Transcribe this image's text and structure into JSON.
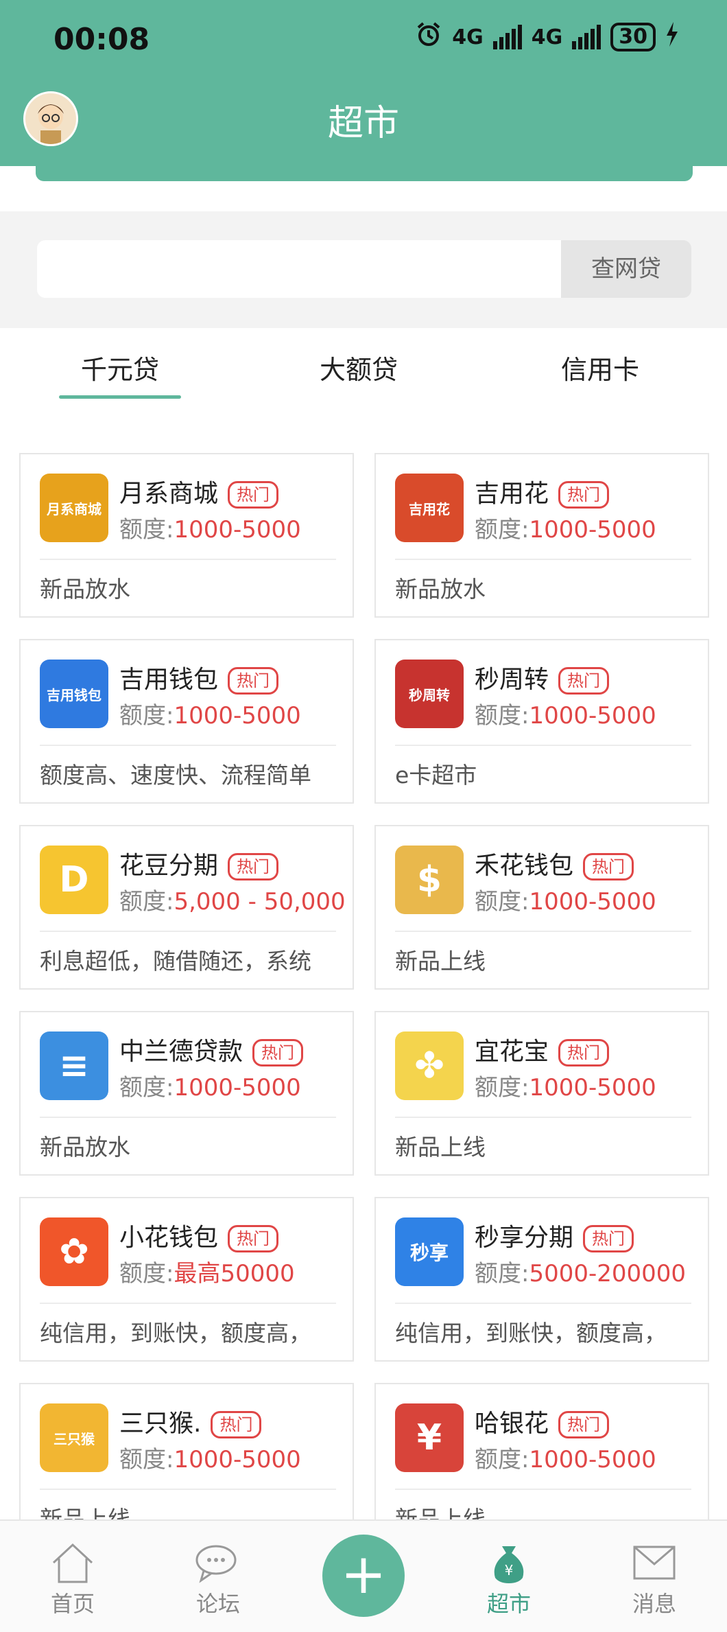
{
  "status_bar": {
    "time": "00:08",
    "net1": "4G",
    "net2": "4G",
    "battery": "30"
  },
  "header": {
    "title": "超市"
  },
  "search": {
    "placeholder": "",
    "button_label": "查网贷"
  },
  "tabs": [
    {
      "label": "千元贷",
      "active": true
    },
    {
      "label": "大额贷",
      "active": false
    },
    {
      "label": "信用卡",
      "active": false
    }
  ],
  "quota_label": "额度:",
  "products": [
    {
      "name": "月系商城",
      "badge": "热门",
      "amount": "1000-5000",
      "desc": "新品放水",
      "logo_text": "月系商城",
      "logo_color": "#e7a21c"
    },
    {
      "name": "吉用花",
      "badge": "热门",
      "amount": "1000-5000",
      "desc": "新品放水",
      "logo_text": "吉用花",
      "logo_color": "#d94b2b"
    },
    {
      "name": "吉用钱包",
      "badge": "热门",
      "amount": "1000-5000",
      "desc": "额度高、速度快、流程简单",
      "logo_text": "吉用钱包",
      "logo_color": "#2f7ae0"
    },
    {
      "name": "秒周转",
      "badge": "热门",
      "amount": "1000-5000",
      "desc": "e卡超市",
      "logo_text": "秒周转",
      "logo_color": "#c7332f"
    },
    {
      "name": "花豆分期",
      "badge": "热门",
      "amount": "5,000 - 50,000",
      "desc": "利息超低，随借随还，系统",
      "logo_text": "D",
      "logo_color": "#f6c530"
    },
    {
      "name": "禾花钱包",
      "badge": "热门",
      "amount": "1000-5000",
      "desc": "新品上线",
      "logo_text": "$",
      "logo_color": "#e9b84c"
    },
    {
      "name": "中兰德贷款",
      "badge": "热门",
      "amount": "1000-5000",
      "desc": "新品放水",
      "logo_text": "≡",
      "logo_color": "#3c8fe0"
    },
    {
      "name": "宜花宝",
      "badge": "热门",
      "amount": "1000-5000",
      "desc": "新品上线",
      "logo_text": "✤",
      "logo_color": "#f4d44d"
    },
    {
      "name": "小花钱包",
      "badge": "热门",
      "amount": "最高50000",
      "desc": "纯信用，到账快，额度高，",
      "logo_text": "✿",
      "logo_color": "#f0562a"
    },
    {
      "name": "秒享分期",
      "badge": "热门",
      "amount": "5000-200000",
      "desc": "纯信用，到账快，额度高，",
      "logo_text": "秒享",
      "logo_color": "#2f82e6"
    },
    {
      "name": "三只猴.",
      "badge": "热门",
      "amount": "1000-5000",
      "desc": "新品上线",
      "logo_text": "三只猴",
      "logo_color": "#f2b632"
    },
    {
      "name": "哈银花",
      "badge": "热门",
      "amount": "1000-5000",
      "desc": "新品上线",
      "logo_text": "¥",
      "logo_color": "#d8443a"
    }
  ],
  "bottom_nav": [
    {
      "label": "首页",
      "icon": "home-icon",
      "active": false
    },
    {
      "label": "论坛",
      "icon": "chat-bubble-icon",
      "active": false
    },
    {
      "label": "",
      "icon": "plus-icon",
      "active": false
    },
    {
      "label": "超市",
      "icon": "money-bag-icon",
      "active": true
    },
    {
      "label": "消息",
      "icon": "envelope-icon",
      "active": false
    }
  ],
  "colors": {
    "primary": "#5fb79c",
    "accent_red": "#e04646"
  }
}
